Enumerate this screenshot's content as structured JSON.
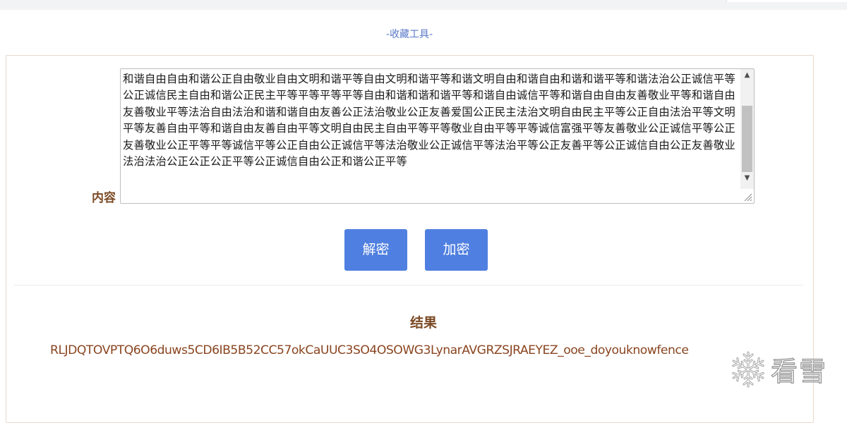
{
  "header": {
    "collect_tool_link": "-收藏工具-"
  },
  "form": {
    "content_label": "内容",
    "content_value": "和谐自由自由和谐公正自由敬业自由文明和谐平等自由文明和谐平等和谐文明自由和谐自由和谐和谐平等和谐法治公正诚信平等公正诚信民主自由和谐公正民主平等平等平等平等自由和谐和谐和谐平等和谐自由诚信平等和谐自由自由友善敬业平等和谐自由友善敬业平等法治自由法治和谐和谐自由友善公正法治敬业公正友善爱国公正民主法治文明自由民主平等公正自由法治平等文明平等友善自由平等和谐自由友善自由平等文明自由民主自由平等平等敬业自由平等平等诚信富强平等友善敬业公正诚信平等公正友善敬业公正平等平等诚信平等公正自由公正诚信平等法治敬业公正诚信平等法治平等公正友善平等公正诚信自由公正友善敬业法治法治公正公正公正平等公正诚信自由公正和谐公正平等",
    "scrollbar": {
      "up_glyph": "▲",
      "down_glyph": "▼",
      "position": 0.35
    }
  },
  "buttons": {
    "decrypt_label": "解密",
    "encrypt_label": "加密",
    "color": "#4f7fe0"
  },
  "result": {
    "label": "结果",
    "value": "RLJDQTOVPTQ6O6duws5CD6IB5B52CC57okCaUUC3SO4OSOWG3LynarAVGRZSJRAEYEZ_ooe_doyouknowfence"
  },
  "watermark": {
    "text": "看雪",
    "icon": "snowflake-icon"
  },
  "colors": {
    "label_brown": "#7a4a25",
    "result_text": "#8a4520",
    "link_blue": "#5a78c8"
  }
}
